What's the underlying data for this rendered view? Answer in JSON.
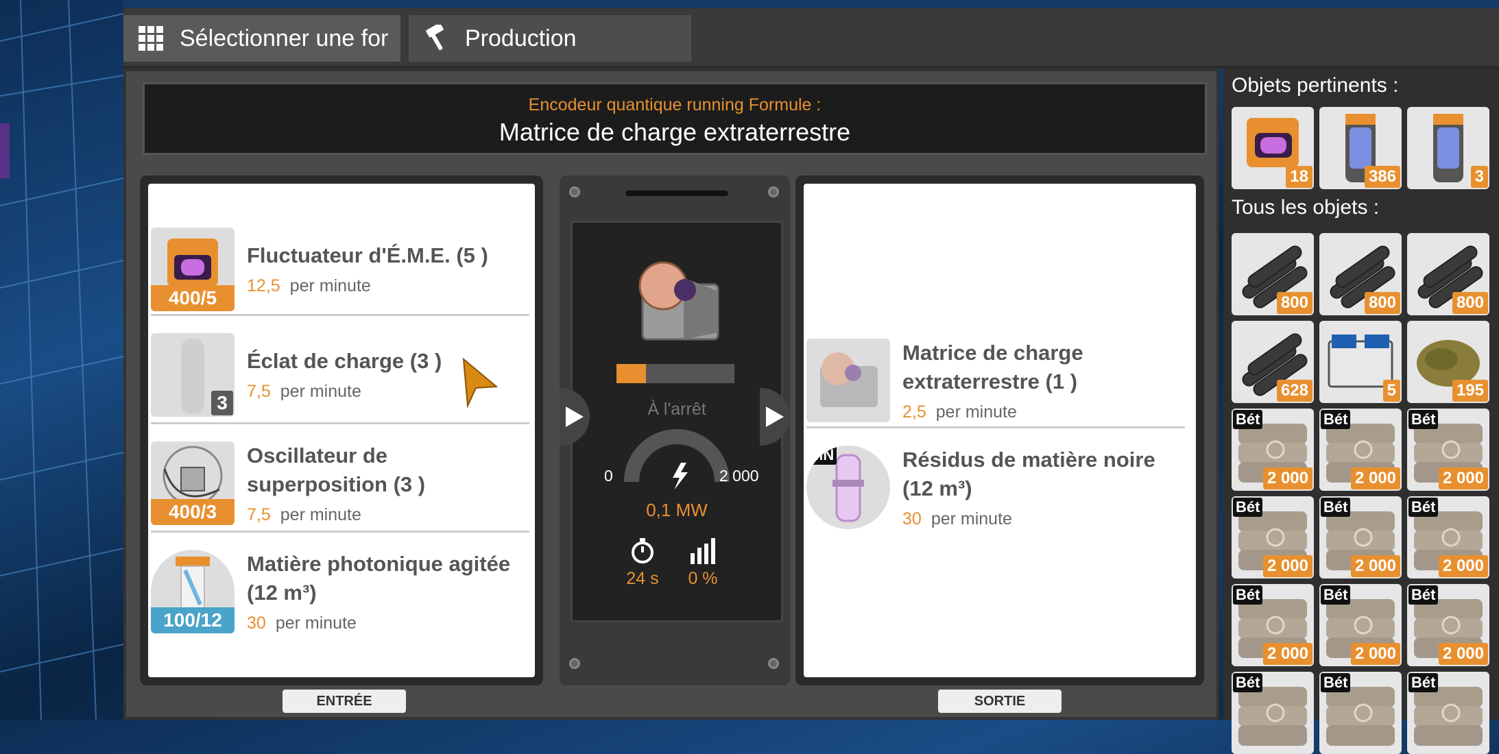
{
  "tabs": [
    {
      "label": "Sélectionner une for",
      "icon": "grid-icon"
    },
    {
      "label": "Production",
      "icon": "hammer-icon"
    }
  ],
  "header": {
    "subtitle": "Encodeur quantique running Formule :",
    "title": "Matrice de charge extraterrestre"
  },
  "inputs": [
    {
      "name": "Fluctuateur d'É.M.E. (5 )",
      "rate": "12,5",
      "unit": "per minute",
      "badge": "400/5",
      "badge_color": "#e8902f"
    },
    {
      "name": "Éclat de charge (3 )",
      "rate": "7,5",
      "unit": "per minute",
      "badge": "3",
      "badge_color": "#5a5a5a"
    },
    {
      "name": "Oscillateur de superposition (3 )",
      "rate": "7,5",
      "unit": "per minute",
      "badge": "400/3",
      "badge_color": "#e8902f"
    },
    {
      "name": "Matière photonique agitée (12 m³)",
      "rate": "30",
      "unit": "per minute",
      "badge": "100/12",
      "badge_color": "#4aa3c9"
    }
  ],
  "machine": {
    "progress": 0.25,
    "status": "À l'arrêt",
    "gauge_min": "0",
    "gauge_max": "2 000",
    "power": "0,1 MW",
    "cycle_time": "24 s",
    "productivity": "0 %"
  },
  "outputs": [
    {
      "name": "Matrice de charge extraterrestre (1 )",
      "rate": "2,5",
      "unit": "per minute"
    },
    {
      "name": "Résidus de matière noire (12 m³)",
      "rate": "30",
      "unit": "per minute",
      "tag": "MN"
    }
  ],
  "footer": {
    "input_label": "ENTRÉE",
    "output_label": "SORTIE"
  },
  "sidebar": {
    "relevant_title": "Objets pertinents :",
    "relevant": [
      {
        "count": "18",
        "icon": "eme-fluctuator-icon"
      },
      {
        "count": "386",
        "icon": "canister-icon"
      },
      {
        "count": "3",
        "icon": "canister-icon"
      }
    ],
    "all_title": "Tous les objets :",
    "all": [
      {
        "count": "800",
        "icon": "pipes-icon",
        "tag": ""
      },
      {
        "count": "800",
        "icon": "pipes-icon",
        "tag": ""
      },
      {
        "count": "800",
        "icon": "pipes-icon",
        "tag": ""
      },
      {
        "count": "628",
        "icon": "pipes-icon",
        "tag": ""
      },
      {
        "count": "5",
        "icon": "battery-icon",
        "tag": ""
      },
      {
        "count": "195",
        "icon": "leaves-icon",
        "tag": ""
      },
      {
        "count": "2 000",
        "icon": "concrete-bag-icon",
        "tag": "Bét"
      },
      {
        "count": "2 000",
        "icon": "concrete-bag-icon",
        "tag": "Bét"
      },
      {
        "count": "2 000",
        "icon": "concrete-bag-icon",
        "tag": "Bét"
      },
      {
        "count": "2 000",
        "icon": "concrete-bag-icon",
        "tag": "Bét"
      },
      {
        "count": "2 000",
        "icon": "concrete-bag-icon",
        "tag": "Bét"
      },
      {
        "count": "2 000",
        "icon": "concrete-bag-icon",
        "tag": "Bét"
      },
      {
        "count": "2 000",
        "icon": "concrete-bag-icon",
        "tag": "Bét"
      },
      {
        "count": "2 000",
        "icon": "concrete-bag-icon",
        "tag": "Bét"
      },
      {
        "count": "2 000",
        "icon": "concrete-bag-icon",
        "tag": "Bét"
      },
      {
        "count": "",
        "icon": "concrete-bag-icon",
        "tag": "Bét"
      },
      {
        "count": "",
        "icon": "concrete-bag-icon",
        "tag": "Bét"
      },
      {
        "count": "",
        "icon": "concrete-bag-icon",
        "tag": "Bét"
      }
    ]
  }
}
